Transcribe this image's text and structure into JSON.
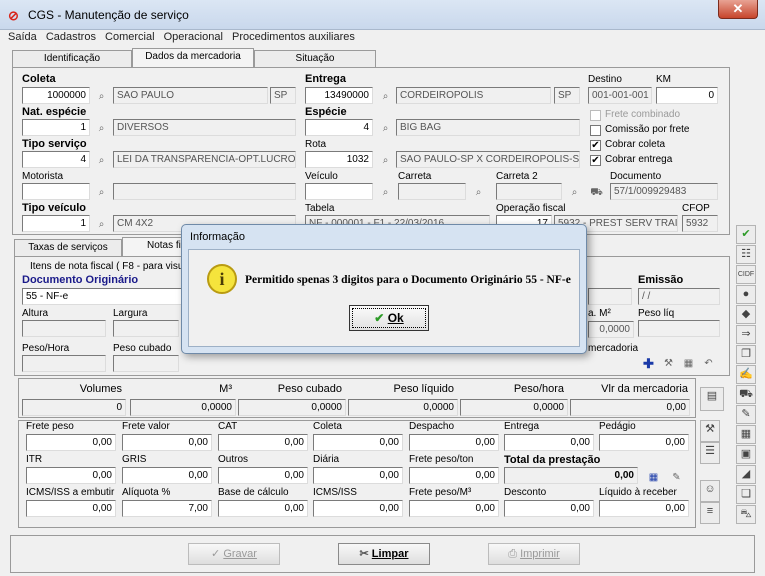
{
  "window": {
    "title": "CGS - Manutenção de serviço",
    "close_glyph": "✕"
  },
  "menu": [
    "Saída",
    "Cadastros",
    "Comercial",
    "Operacional",
    "Procedimentos auxiliares"
  ],
  "tabs": [
    "Identificação",
    "Dados da mercadoria",
    "Situação"
  ],
  "main": {
    "coleta": {
      "label": "Coleta",
      "code": "1000000",
      "city": "SAO PAULO",
      "uf": "SP"
    },
    "entrega": {
      "label": "Entrega",
      "code": "13490000",
      "city": "CORDEIROPOLIS",
      "uf": "SP"
    },
    "destino": {
      "label": "Destino",
      "value": "001-001-001"
    },
    "km": {
      "label": "KM",
      "value": "0"
    },
    "nat_especie": {
      "label": "Nat. espécie",
      "code": "1",
      "desc": "DIVERSOS"
    },
    "especie": {
      "label": "Espécie",
      "code": "4",
      "desc": "BIG BAG"
    },
    "tipo_servico": {
      "label": "Tipo serviço",
      "code": "4",
      "desc": "LEI DA TRANSPARENCIA-OPT.LUCRO"
    },
    "rota": {
      "label": "Rota",
      "code": "1032",
      "desc": "SAO PAULO-SP X CORDEIROPOLIS-SF"
    },
    "motorista": {
      "label": "Motorista",
      "code": "",
      "desc": ""
    },
    "veiculo": {
      "label": "Veículo",
      "value": ""
    },
    "carreta": {
      "label": "Carreta",
      "value": ""
    },
    "carreta2": {
      "label": "Carreta 2",
      "value": ""
    },
    "documento": {
      "label": "Documento",
      "value": "57/1/009929483"
    },
    "tipo_veiculo": {
      "label": "Tipo veículo",
      "code": "1",
      "desc": "CM 4X2"
    },
    "tabela": {
      "label": "Tabela",
      "value": "NF - 000001 - F1 - 22/03/2016"
    },
    "operacao_fiscal": {
      "label": "Operação fiscal",
      "code": "17",
      "desc": "5932 - PREST SERV TRAI"
    },
    "cfop": {
      "label": "CFOP",
      "value": "5932"
    },
    "checks": [
      {
        "label": "Frete combinado",
        "checked": false,
        "enabled": false
      },
      {
        "label": "Comissão por frete",
        "checked": false,
        "enabled": true
      },
      {
        "label": "Cobrar coleta",
        "checked": true,
        "enabled": true
      },
      {
        "label": "Cobrar entrega",
        "checked": true,
        "enabled": true
      }
    ],
    "check_mark": "✔"
  },
  "subtabs": [
    "Taxas de serviços",
    "Notas fi"
  ],
  "nf": {
    "group_label": "Itens de nota fiscal ( F8 - para visu",
    "doc_orig_label": "Documento Originário",
    "doc_orig_value": "55 - NF-e",
    "emissao_label": "Emissão",
    "emissao_value": "/ /",
    "altura": "Altura",
    "largura": "Largura",
    "m2": "a. M²",
    "m2_value": "0,0000",
    "peso_liq": "Peso líq",
    "peso_hora": "Peso/Hora",
    "peso_cubado": "Peso cubado",
    "mercadoria": "mercadoria"
  },
  "totals": {
    "headers": [
      "Volumes",
      "M³",
      "Peso cubado",
      "Peso líquido",
      "Peso/hora",
      "Vlr da mercadoria"
    ],
    "values": [
      "0",
      "0,0000",
      "0,0000",
      "0,0000",
      "0,0000",
      "0,00"
    ]
  },
  "frete": [
    [
      {
        "label": "Frete peso",
        "value": "0,00"
      },
      {
        "label": "Frete valor",
        "value": "0,00"
      },
      {
        "label": "CAT",
        "value": "0,00"
      },
      {
        "label": "Coleta",
        "value": "0,00"
      },
      {
        "label": "Despacho",
        "value": "0,00"
      },
      {
        "label": "Entrega",
        "value": "0,00"
      },
      {
        "label": "Pedágio",
        "value": "0,00"
      }
    ],
    [
      {
        "label": "ITR",
        "value": "0,00"
      },
      {
        "label": "GRIS",
        "value": "0,00"
      },
      {
        "label": "Outros",
        "value": "0,00"
      },
      {
        "label": "Diária",
        "value": "0,00"
      },
      {
        "label": "Frete peso/ton",
        "value": "0,00"
      },
      {
        "label": "Total da prestação",
        "value": "0,00"
      }
    ],
    [
      {
        "label": "ICMS/ISS a embutir",
        "value": "0,00"
      },
      {
        "label": "Alíquota %",
        "value": "7,00"
      },
      {
        "label": "Base de cálculo",
        "value": "0,00"
      },
      {
        "label": "ICMS/ISS",
        "value": "0,00"
      },
      {
        "label": "Frete peso/M³",
        "value": "0,00"
      },
      {
        "label": "Desconto",
        "value": "0,00"
      },
      {
        "label": "Líquido à receber",
        "value": "0,00"
      }
    ]
  ],
  "buttons": {
    "gravar": "Gravar",
    "limpar": "Limpar",
    "imprimir": "Imprimir"
  },
  "dialog": {
    "title": "Informação",
    "message": "Permitido spenas 3 digitos para o Documento Originário 55 - NF-e",
    "ok": "Ok",
    "icon": "i"
  }
}
